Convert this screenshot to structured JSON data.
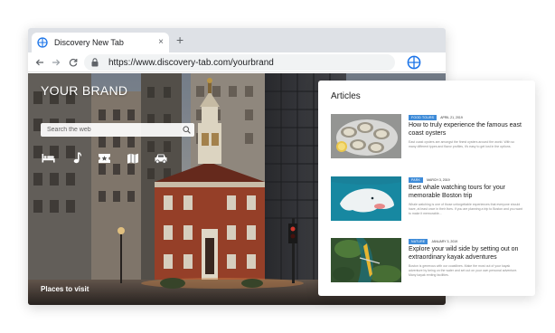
{
  "browser": {
    "tab_title": "Discovery New Tab",
    "close_symbol": "×",
    "new_tab_symbol": "+",
    "url": "https://www.discovery-tab.com/yourbrand",
    "accent_color": "#1a73e8"
  },
  "hero": {
    "brand": "YOUR BRAND",
    "search_placeholder": "Search the web",
    "shortcuts": [
      "bed-icon",
      "music-note-icon",
      "ticket-icon",
      "map-icon",
      "car-icon"
    ],
    "places_label": "Places to visit"
  },
  "articles": {
    "heading": "Articles",
    "items": [
      {
        "category": "FOOD TOURS",
        "date": "APRIL 21, 2019",
        "title": "How to truly experience the famous east coast oysters",
        "summary": "East coast oysters are amongst the finest oysters around the world. With so many different types and flavor profiles, it's easy to get lost in the options.",
        "thumb": "oysters"
      },
      {
        "category": "PARK",
        "date": "MARCH 3, 2019",
        "title": "Best whale watching tours for your memorable Boston trip",
        "summary": "Whale watching is one of those unforgettable experiences that everyone should have, at least once in their lives. If you are planning a trip to Boston and you want to make it memorable...",
        "thumb": "beluga"
      },
      {
        "category": "NATURE",
        "date": "January 3, 2019",
        "title": "Explore your wild side by setting out on extraordinary kayak adventures",
        "summary": "Boston is generous with our coastlines. Make the most out of your kayak adventure by being on the water and set out on your own personal adventure. Many kayak renting facilities.",
        "thumb": "kayak"
      }
    ],
    "badge_color": "#3e8bd8"
  }
}
